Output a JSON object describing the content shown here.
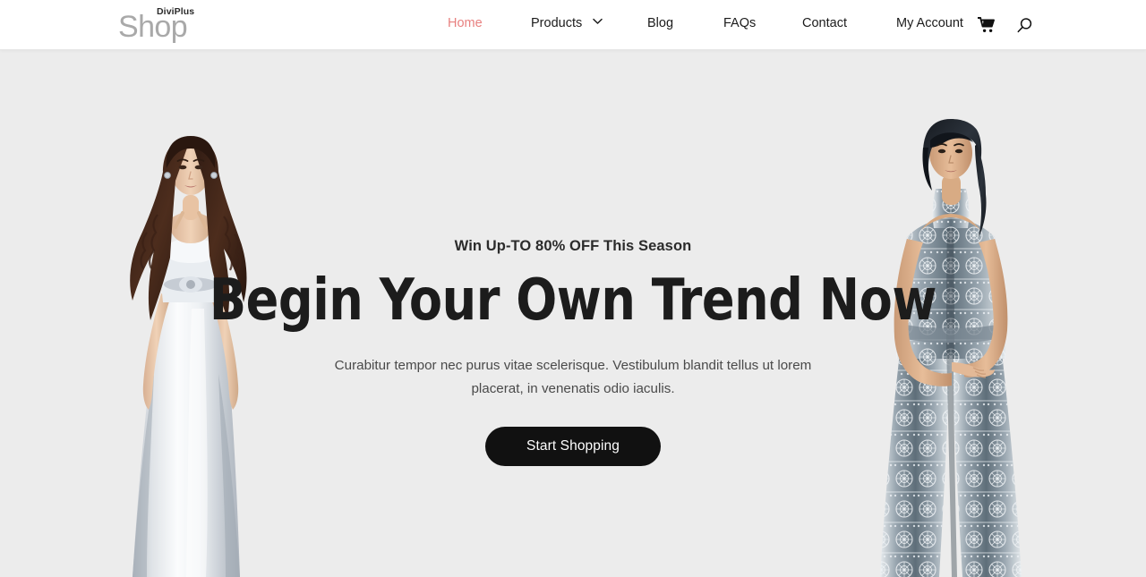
{
  "site": {
    "logo_main": "Shop",
    "logo_sub": "DiviPlus"
  },
  "header": {
    "nav": [
      {
        "id": "home",
        "label": "Home",
        "active": true,
        "has_dropdown": false
      },
      {
        "id": "products",
        "label": "Products",
        "active": false,
        "has_dropdown": true
      },
      {
        "id": "blog",
        "label": "Blog",
        "active": false,
        "has_dropdown": false
      },
      {
        "id": "faqs",
        "label": "FAQs",
        "active": false,
        "has_dropdown": false
      },
      {
        "id": "contact",
        "label": "Contact",
        "active": false,
        "has_dropdown": false
      },
      {
        "id": "account",
        "label": "My Account",
        "active": false,
        "has_dropdown": false
      }
    ],
    "cart_icon": "shopping-cart-icon",
    "search_icon": "search-icon",
    "active_color": "#e8807f",
    "text_color": "#1b1b1b",
    "background": "#ffffff"
  },
  "hero": {
    "eyebrow": "Win Up-TO 80% OFF This Season",
    "title": "Begin Your Own Trend Now",
    "paragraph": "Curabitur tempor nec purus vitae scelerisque. Vestibulum blandit tellus ut lorem placerat, in venenatis odio iaculis.",
    "cta_label": "Start Shopping",
    "cta_background": "#111111",
    "cta_text_color": "#ffffff",
    "background": "#ececec",
    "left_image_alt": "model-in-white-gown",
    "right_image_alt": "model-in-grey-patterned-outfit"
  }
}
